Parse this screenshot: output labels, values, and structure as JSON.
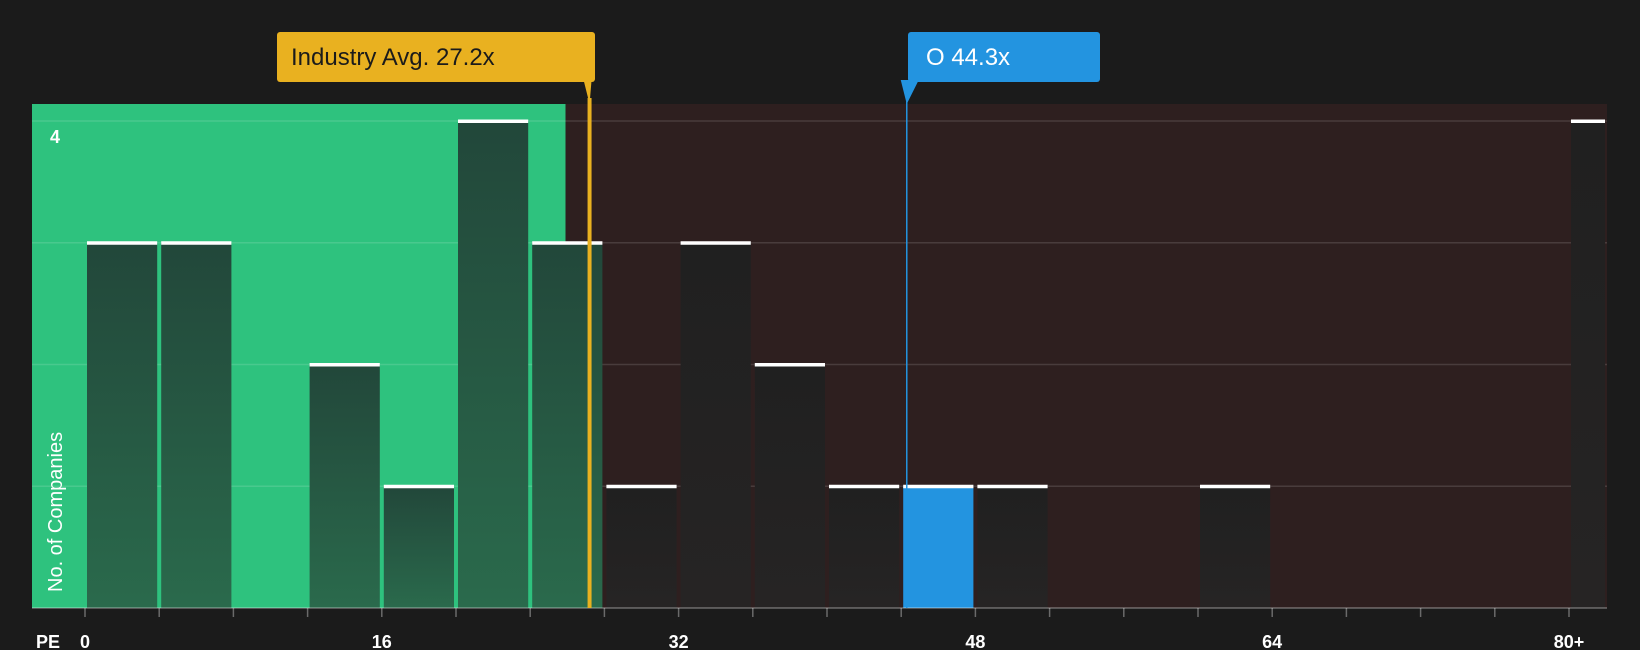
{
  "chart_data": {
    "type": "bar",
    "xlabel": "PE",
    "ylabel": "No. of Companies",
    "x_ticks": [
      "0",
      "16",
      "32",
      "48",
      "64",
      "80+"
    ],
    "y_ticks": [
      "4"
    ],
    "ylim": [
      0,
      4
    ],
    "xlim": [
      0,
      82
    ],
    "bin_width": 4,
    "bins": [
      {
        "x0": 0,
        "x1": 4,
        "count": 3
      },
      {
        "x0": 4,
        "x1": 8,
        "count": 3
      },
      {
        "x0": 12,
        "x1": 16,
        "count": 2
      },
      {
        "x0": 16,
        "x1": 20,
        "count": 1
      },
      {
        "x0": 20,
        "x1": 24,
        "count": 4
      },
      {
        "x0": 24,
        "x1": 28,
        "count": 3
      },
      {
        "x0": 28,
        "x1": 32,
        "count": 1
      },
      {
        "x0": 32,
        "x1": 36,
        "count": 3
      },
      {
        "x0": 36,
        "x1": 40,
        "count": 2
      },
      {
        "x0": 40,
        "x1": 44,
        "count": 1
      },
      {
        "x0": 44,
        "x1": 48,
        "count": 1,
        "highlight": true
      },
      {
        "x0": 48,
        "x1": 52,
        "count": 1
      },
      {
        "x0": 60,
        "x1": 64,
        "count": 1
      },
      {
        "x0": 80,
        "x1": 82,
        "count": 4
      }
    ],
    "industry_avg": {
      "label": "Industry Avg. 27.2x",
      "value": 27.2
    },
    "company": {
      "label": "O 44.3x",
      "value": 44.3
    },
    "colors": {
      "fair_zone": "#2ec27e",
      "expensive_zone": "#2e1f1f",
      "bar_dark": "#234d38",
      "bar_neutral": "#242424",
      "highlight": "#2394e0",
      "industry": "#e9b120",
      "cap": "#ffffff"
    },
    "grid": true
  }
}
